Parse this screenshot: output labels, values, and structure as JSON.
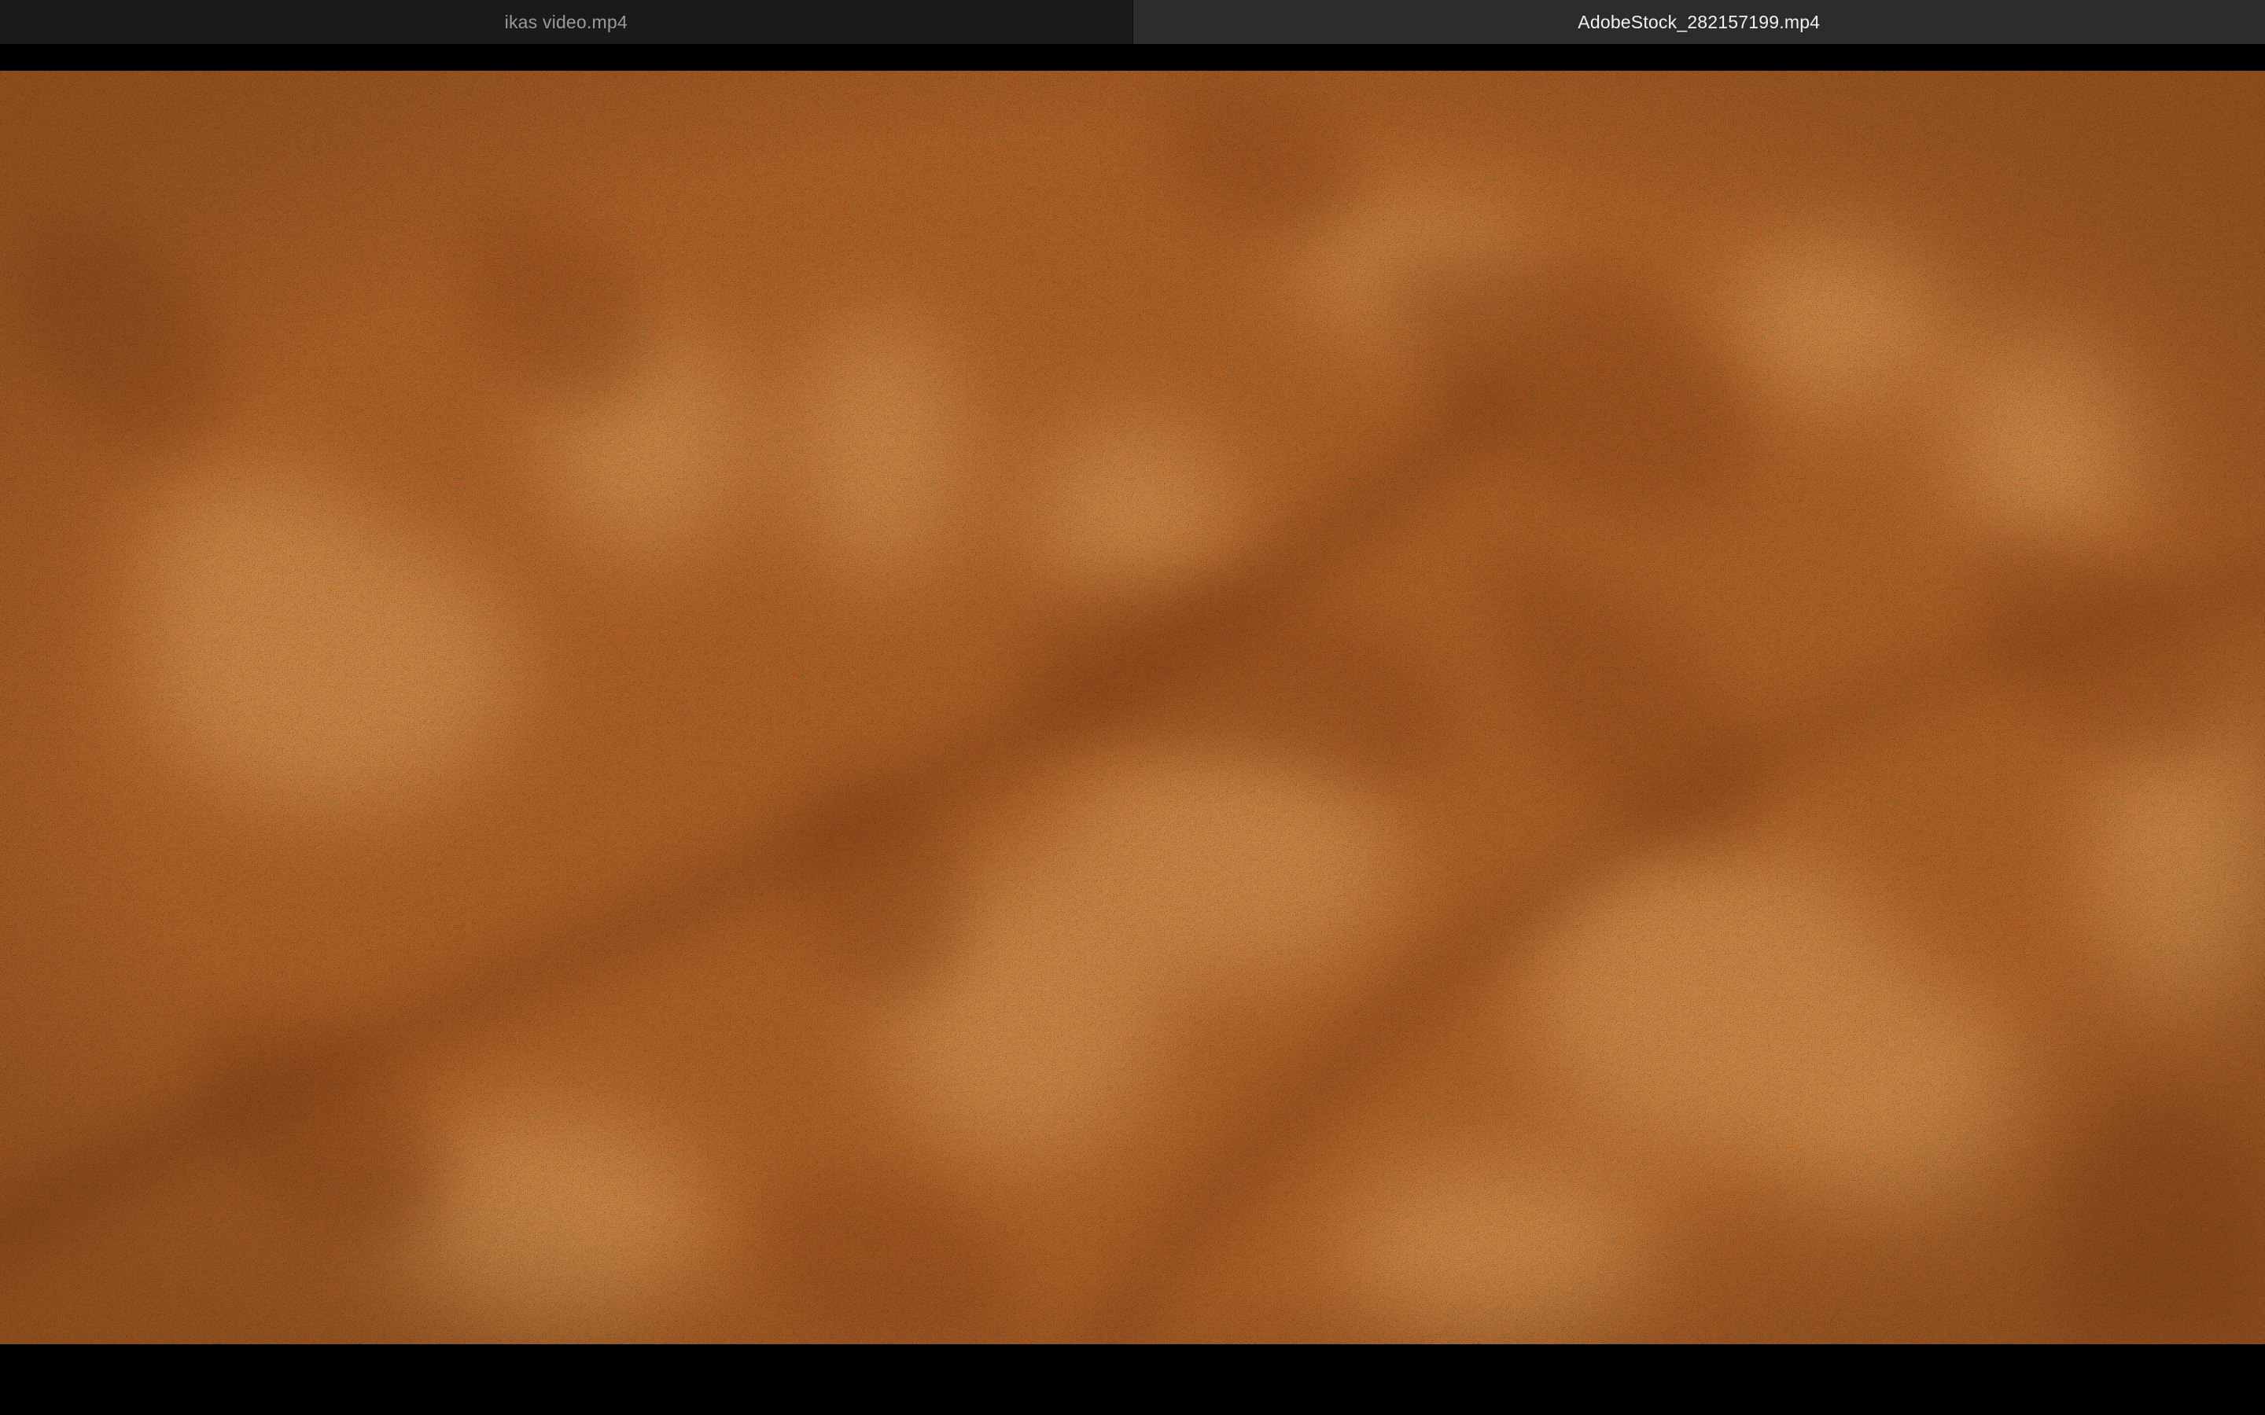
{
  "window": {
    "tabs": [
      {
        "label": "ikas video.mp4",
        "active": false
      },
      {
        "label": "AdobeStock_282157199.mp4",
        "active": true
      }
    ]
  },
  "video": {
    "content": "plaster-wall-with-leaf-shadows",
    "colors": {
      "base": "#c9843f",
      "highlight": "#f2c07a",
      "shadow": "#a8652a",
      "letterbox": "#000000"
    }
  }
}
